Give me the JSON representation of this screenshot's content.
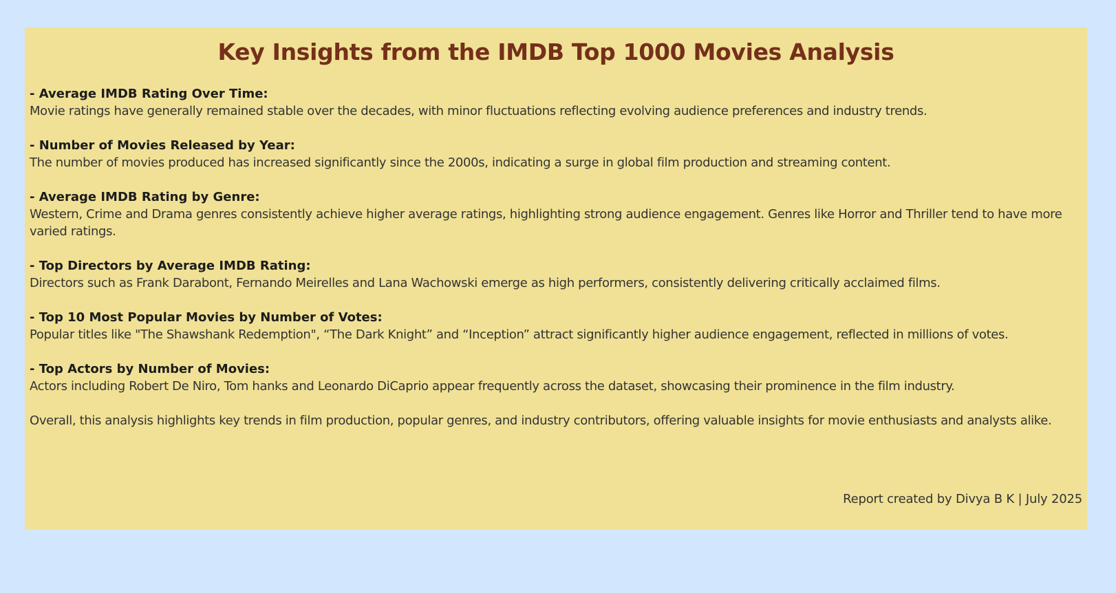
{
  "title": "Key Insights from the IMDB Top 1000 Movies Analysis",
  "sections": [
    {
      "heading": "- Average IMDB Rating Over Time:",
      "body": "Movie ratings have generally remained stable over the decades, with minor fluctuations reflecting evolving audience preferences and industry trends."
    },
    {
      "heading": "- Number of Movies Released by Year:",
      "body": "The number of movies produced has increased significantly since the 2000s, indicating a surge in global film production and streaming content."
    },
    {
      "heading": "- Average IMDB Rating by Genre:",
      "body": "Western, Crime and Drama genres consistently achieve higher average ratings, highlighting strong audience engagement. Genres like Horror and Thriller tend to have more varied ratings."
    },
    {
      "heading": "- Top Directors by Average IMDB Rating:",
      "body": "Directors such as Frank Darabont, Fernando Meirelles and Lana Wachowski emerge as high performers, consistently delivering critically acclaimed films."
    },
    {
      "heading": "- Top 10 Most Popular Movies by Number of Votes:",
      "body": "Popular titles like \"The Shawshank Redemption\", “The Dark Knight” and “Inception” attract significantly higher audience engagement, reflected in millions of votes."
    },
    {
      "heading": "- Top Actors by Number of Movies:",
      "body": "Actors including Robert De Niro, Tom hanks and Leonardo DiCaprio appear frequently across the dataset, showcasing their prominence in the film industry."
    }
  ],
  "conclusion": "Overall, this analysis highlights key trends in film production, popular genres, and industry contributors, offering valuable insights for movie enthusiasts and analysts alike.",
  "footer": "Report created by Divya B K | July 2025",
  "colors": {
    "background": "#d2e6fd",
    "panel": "#f0e196",
    "title": "#74301a"
  }
}
